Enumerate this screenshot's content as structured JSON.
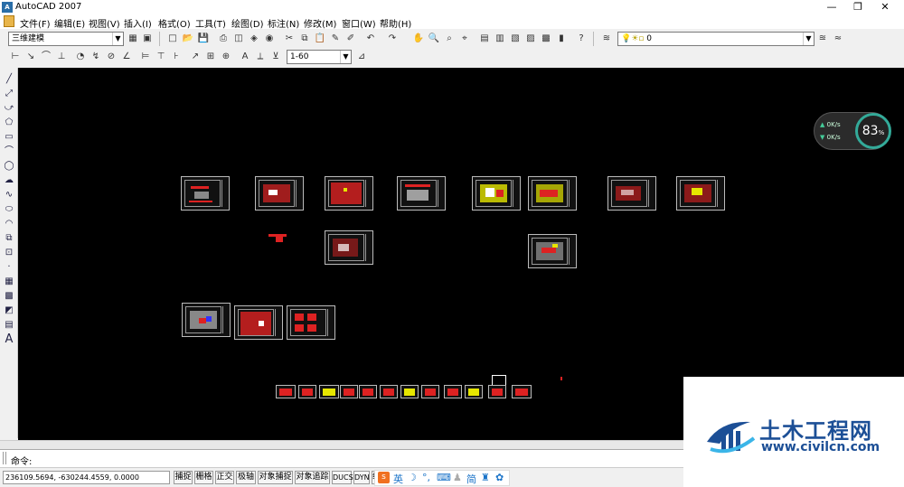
{
  "window": {
    "title": "AutoCAD 2007",
    "minimize": "—",
    "maximize": "❐",
    "close": "✕"
  },
  "menu": [
    "文件(F)",
    "编辑(E)",
    "视图(V)",
    "插入(I)",
    "格式(O)",
    "工具(T)",
    "绘图(D)",
    "标注(N)",
    "修改(M)",
    "窗口(W)",
    "帮助(H)"
  ],
  "toolbar": {
    "workspace": "三维建模",
    "layer": "0",
    "dimstyle": "1-60"
  },
  "netmon": {
    "up": "0K/s",
    "down": "0K/s",
    "percent": "83",
    "unit": "%"
  },
  "command": {
    "prompt": "命令:"
  },
  "status": {
    "coords": "236109.5694, -630244.4559, 0.0000",
    "buttons": [
      "捕捉",
      "栅格",
      "正交",
      "极轴",
      "对象捕捉",
      "对象追踪",
      "DUCS",
      "DYN",
      "线宽"
    ]
  },
  "ime": {
    "lang": "英",
    "simplified": "简"
  },
  "watermark": {
    "title": "土木工程网",
    "url": "www.civilcn.com"
  }
}
